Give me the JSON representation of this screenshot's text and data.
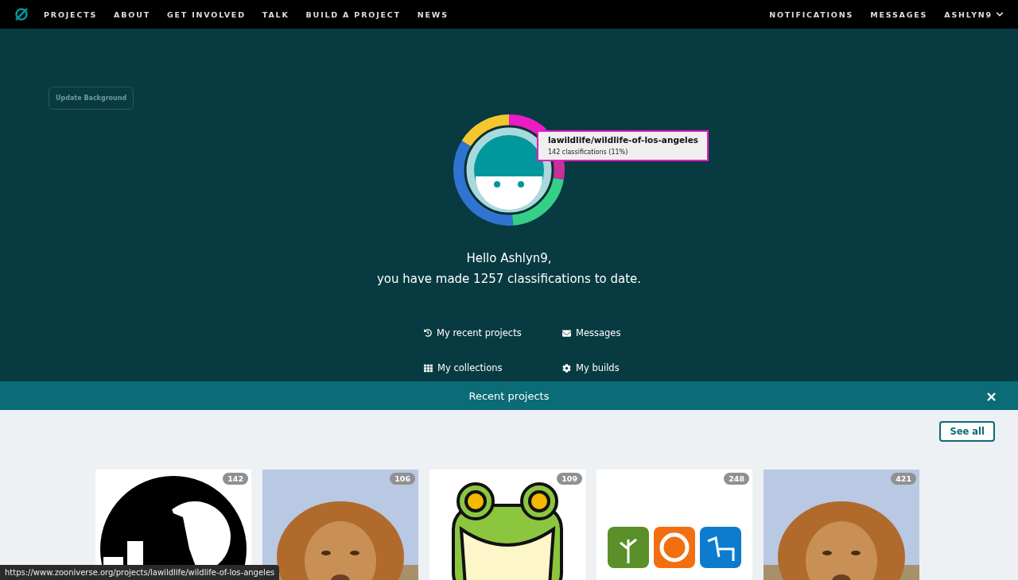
{
  "nav": {
    "left": [
      "PROJECTS",
      "ABOUT",
      "GET INVOLVED",
      "TALK",
      "BUILD A PROJECT",
      "NEWS"
    ],
    "right": [
      "NOTIFICATIONS",
      "MESSAGES"
    ],
    "user": "ASHLYN9"
  },
  "hero": {
    "update_button": "Update Background",
    "tooltip": {
      "title": "lawildlife/wildlife-of-los-angeles",
      "detail": "142 classifications (11%)"
    },
    "greeting": "Hello Ashlyn9,",
    "summary": "you have made 1257 classifications to date.",
    "links": [
      {
        "kind": "recent",
        "label": "My recent projects"
      },
      {
        "kind": "messages",
        "label": "Messages"
      },
      {
        "kind": "collections",
        "label": "My collections"
      },
      {
        "kind": "builds",
        "label": "My builds"
      }
    ]
  },
  "recent": {
    "title": "Recent projects",
    "close": "×",
    "see_all": "See all",
    "projects": [
      {
        "kind": "wolf",
        "count": "142"
      },
      {
        "count": "106"
      },
      {
        "kind": "frog",
        "count": "109"
      },
      {
        "kind": "icons",
        "count": "248"
      },
      {
        "count": "421"
      }
    ]
  },
  "status_bar": "https://www.zooniverse.org/projects/lawildlife/wildlife-of-los-angeles"
}
